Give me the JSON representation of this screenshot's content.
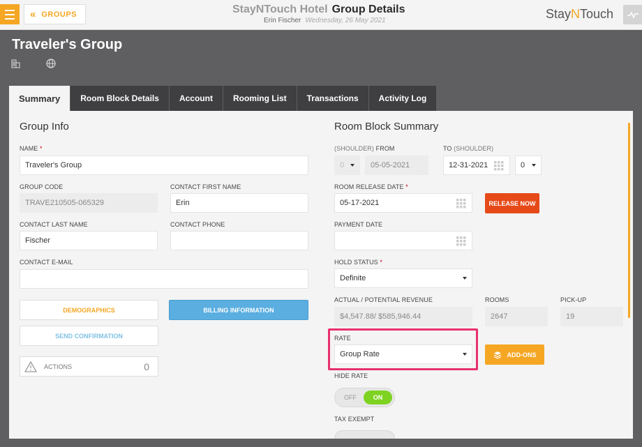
{
  "topbar": {
    "back_label": "GROUPS",
    "hotel_name": "StayNTouch Hotel",
    "page_title": "Group Details",
    "user_name": "Erin Fischer",
    "date": "Wednesday, 26 May 2021",
    "logo_left": "Stay",
    "logo_n": "N",
    "logo_right": "Touch"
  },
  "group": {
    "name": "Traveler's Group"
  },
  "tabs": [
    "Summary",
    "Room Block Details",
    "Account",
    "Rooming List",
    "Transactions",
    "Activity Log"
  ],
  "group_info": {
    "title": "Group Info",
    "name_label": "NAME",
    "name_value": "Traveler's Group",
    "code_label": "GROUP CODE",
    "code_value": "TRAVE210505-065329",
    "first_name_label": "CONTACT FIRST NAME",
    "first_name_value": "Erin",
    "last_name_label": "CONTACT LAST NAME",
    "last_name_value": "Fischer",
    "phone_label": "CONTACT PHONE",
    "phone_value": "",
    "email_label": "CONTACT E-MAIL",
    "email_value": "",
    "demographics_btn": "DEMOGRAPHICS",
    "billing_btn": "BILLING INFORMATION",
    "send_btn": "SEND CONFIRMATION",
    "actions_label": "ACTIONS",
    "actions_count": "0"
  },
  "room_block": {
    "title": "Room Block Summary",
    "from_label_light": "(SHOULDER)",
    "from_label": "FROM",
    "from_shoulder_value": "0",
    "from_date": "05-05-2021",
    "to_label": "TO",
    "to_label_light": "(SHOULDER)",
    "to_date": "12-31-2021",
    "to_shoulder_value": "0",
    "release_date_label": "ROOM RELEASE DATE",
    "release_date_value": "05-17-2021",
    "release_btn": "RELEASE NOW",
    "payment_date_label": "PAYMENT DATE",
    "payment_date_value": "",
    "hold_status_label": "HOLD STATUS",
    "hold_status_value": "Definite",
    "revenue_label": "ACTUAL / POTENTIAL REVENUE",
    "revenue_value": "$4,547.88/ $585,946.44",
    "rooms_label": "ROOMS",
    "rooms_value": "2647",
    "pickup_label": "PICK-UP",
    "pickup_value": "19",
    "rate_label": "RATE",
    "rate_value": "Group Rate",
    "addons_btn": "ADD-ONS",
    "hide_rate_label": "HIDE RATE",
    "toggle_off": "OFF",
    "toggle_on": "ON",
    "tax_exempt_label": "TAX EXEMPT"
  },
  "colors": {
    "accent": "#f5a623",
    "billing": "#5aaee0",
    "release": "#e64a19",
    "toggle_on": "#7ed321",
    "highlight": "#e8306e"
  }
}
